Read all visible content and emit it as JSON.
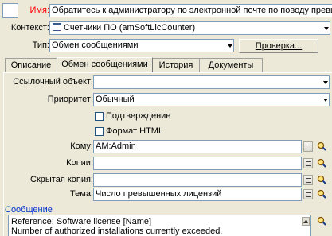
{
  "header": {
    "name_label": "Имя:",
    "name_value": "Обратитесь к администратору по электронной почте по поводу превы",
    "context_label": "Контекст:",
    "context_value": "Счетчики ПО (amSoftLicCounter)",
    "type_label": "Тип:",
    "type_value": "Обмен сообщениями",
    "check_button": "Проверка..."
  },
  "tabs": [
    {
      "label": "Описание"
    },
    {
      "label": "Обмен сообщениями"
    },
    {
      "label": "История"
    },
    {
      "label": "Документы"
    }
  ],
  "form": {
    "ref_object_label": "Ссылочный объект:",
    "ref_object_value": "",
    "priority_label": "Приоритет:",
    "priority_value": "Обычный",
    "confirm_label": "Подтверждение",
    "html_format_label": "Формат HTML",
    "to_label": "Кому:",
    "to_value": "AM:Admin",
    "cc_label": "Копии:",
    "cc_value": "",
    "bcc_label": "Скрытая копия:",
    "bcc_value": "",
    "subject_label": "Тема:",
    "subject_value": "Число превышенных лицензий"
  },
  "message": {
    "group_label": "Сообщение",
    "line1": "Reference: Software license [Name]",
    "line2": "Number of authorized installations currently exceeded."
  },
  "colors": {
    "name_label": "#ff0000",
    "group_label": "#0033cc"
  }
}
